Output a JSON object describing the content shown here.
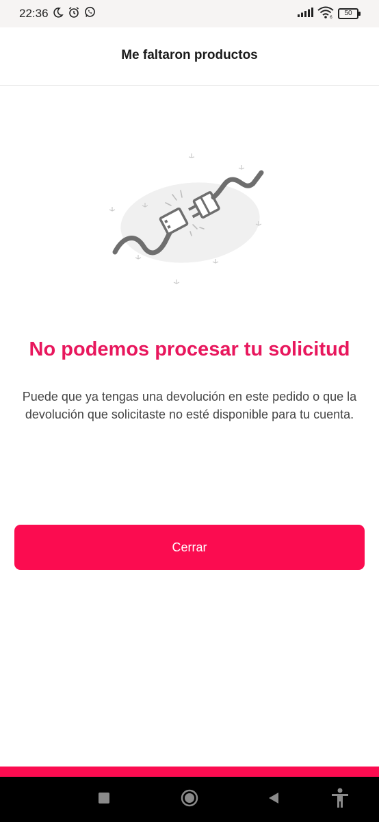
{
  "status_bar": {
    "time": "22:36",
    "battery_level": "50",
    "icons": [
      "moon-icon",
      "alarm-icon",
      "whatsapp-icon",
      "signal-icon",
      "wifi-icon",
      "battery-icon"
    ]
  },
  "header": {
    "title": "Me faltaron productos"
  },
  "illustration": {
    "icon": "disconnected-plug-icon"
  },
  "error": {
    "title": "No podemos procesar tu solicitud",
    "message": "Puede que ya tengas una devolución en este pedido o que la devolución que solicitaste no esté disponible para tu cuenta."
  },
  "actions": {
    "close_label": "Cerrar"
  },
  "nav_bar": {
    "buttons": [
      "recents-square-icon",
      "home-circle-icon",
      "back-triangle-icon",
      "accessibility-icon"
    ]
  },
  "colors": {
    "accent": "#fb0c50",
    "title_accent": "#e8175d",
    "text": "#444444",
    "nav_background": "#000000"
  }
}
